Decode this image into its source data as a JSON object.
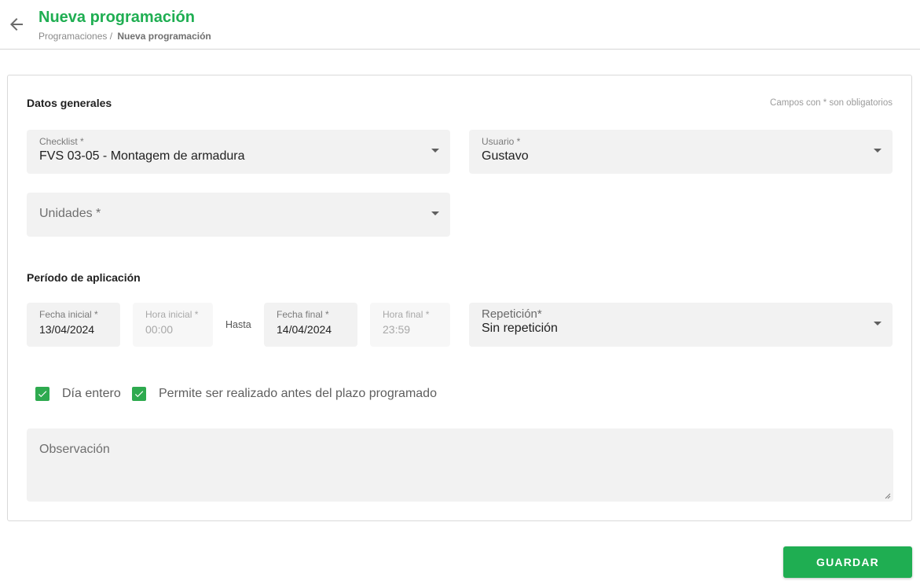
{
  "header": {
    "title": "Nueva programación",
    "breadcrumb": {
      "parent": "Programaciones /",
      "current": "Nueva programación"
    },
    "back_icon": "arrow-left-icon"
  },
  "form": {
    "general": {
      "title": "Datos generales",
      "required_note": "Campos con * son obligatorios",
      "checklist": {
        "label": "Checklist *",
        "value": "FVS 03-05 - Montagem de armadura"
      },
      "usuario": {
        "label": "Usuario *",
        "value": "Gustavo"
      },
      "unidades": {
        "placeholder": "Unidades *"
      }
    },
    "period": {
      "title": "Período de aplicación",
      "fecha_inicial": {
        "label": "Fecha inicial *",
        "value": "13/04/2024"
      },
      "hora_inicial": {
        "label": "Hora inicial *",
        "value": "00:00"
      },
      "hasta": "Hasta",
      "fecha_final": {
        "label": "Fecha final *",
        "value": "14/04/2024"
      },
      "hora_final": {
        "label": "Hora final *",
        "value": "23:59"
      },
      "repeticion": {
        "label": "Repetición*",
        "value": "Sin repetición"
      }
    },
    "options": {
      "dia_entero": {
        "label": "Día entero",
        "checked": true
      },
      "permite": {
        "label": "Permite ser realizado antes del plazo programado",
        "checked": true
      }
    },
    "observacion": {
      "placeholder": "Observación"
    },
    "save_label": "GUARDAR"
  },
  "colors": {
    "accent": "#1fae52",
    "checkbox": "#2eaa4f",
    "field_bg": "#f2f2f2"
  }
}
